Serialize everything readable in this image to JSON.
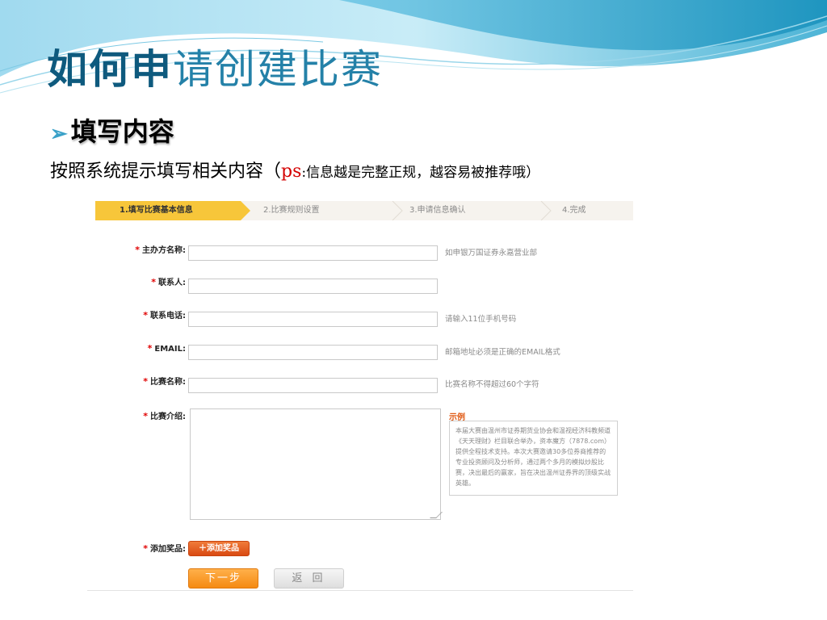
{
  "title": {
    "bold": "如何申",
    "rest": "请创建比赛"
  },
  "section": {
    "heading": "填写内容"
  },
  "instruction": {
    "main": "按照系统提示填写相关内容（",
    "ps": "ps",
    "note": ":信息越是完整正规，越容易被推荐哦）"
  },
  "steps": [
    {
      "label": "1.填写比赛基本信息",
      "state": "active"
    },
    {
      "label": "2.比赛规则设置",
      "state": "inactive"
    },
    {
      "label": "3.申请信息确认",
      "state": "inactive"
    },
    {
      "label": "4.完成",
      "state": "inactive"
    }
  ],
  "form": {
    "required_mark": "*",
    "fields": [
      {
        "label": "主办方名称:",
        "value": "",
        "hint": "如申银万国证券永嘉营业部"
      },
      {
        "label": "联系人:",
        "value": "",
        "hint": ""
      },
      {
        "label": "联系电话:",
        "value": "",
        "hint": "请输入11位手机号码"
      },
      {
        "label": "EMAIL:",
        "value": "",
        "hint": "邮箱地址必须是正确的EMAIL格式"
      },
      {
        "label": "比赛名称:",
        "value": "",
        "hint": "比赛名称不得超过60个字符"
      }
    ],
    "intro": {
      "label": "比赛介绍:",
      "value": "",
      "example_title": "示例",
      "example_text": "本届大赛由温州市证券期货业协会和温视经济科教频道《天天理财》栏目联合举办，资本魔方（7878.com）提供全程技术支持。本次大赛邀请30多位券商推荐的专业投资顾问及分析师，通过两个多月的模拟炒股比赛，决出最后的赢家，旨在决出温州证券界的顶级实战英雄。"
    },
    "prize": {
      "label": "添加奖品:",
      "button": "＋添加奖品"
    },
    "next_button": "下一步",
    "back_button": "返 回"
  },
  "colors": {
    "title_dark": "#0e5a7e",
    "title_light": "#2481a8",
    "step_active": "#f7c63a",
    "accent_orange": "#f58a12",
    "required_red": "#e00000"
  }
}
